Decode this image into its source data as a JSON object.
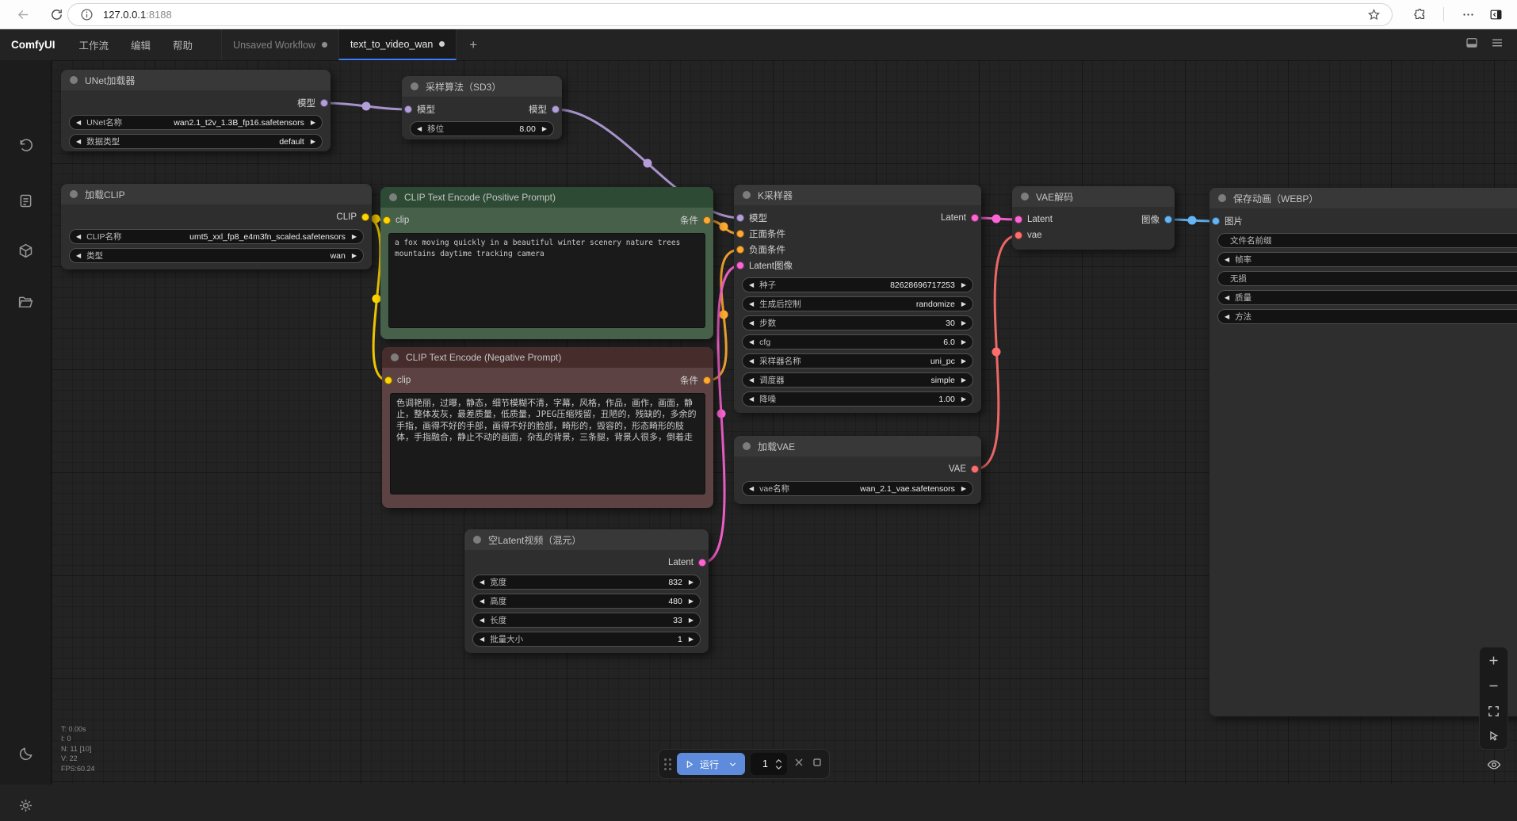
{
  "colors": {
    "model": "#b39ddb",
    "clip": "#ffd500",
    "conditioning": "#ffa931",
    "latent": "#ff64d5",
    "vae": "#ff6e6e",
    "image": "#64b5f6",
    "run_button": "#5f8bdd",
    "active_tab_underline": "#3d7eff"
  },
  "browser": {
    "url_host": "127.0.0.1",
    "url_port": ":8188",
    "icons": [
      "back-icon",
      "refresh-icon",
      "info-icon",
      "star-icon",
      "extensions-puzzle-icon",
      "more-dots-icon",
      "browser-sidebar-icon"
    ]
  },
  "menubar": {
    "logo": "ComfyUI",
    "menu_workflow": "工作流",
    "menu_edit": "编辑",
    "menu_help": "帮助",
    "tab_unsaved": "Unsaved Workflow",
    "tab_active": "text_to_video_wan",
    "icons": [
      "bottom-panel-icon",
      "hamburger-menu-icon"
    ]
  },
  "sidebar_icons": [
    "queue-history-icon",
    "node-library-icon",
    "model-library-icon",
    "workflows-folder-icon",
    "theme-moon-icon",
    "settings-gear-icon"
  ],
  "nodes": {
    "unet_loader": {
      "title": "UNet加载器",
      "outputs": [
        "模型"
      ],
      "widgets": [
        {
          "label": "UNet名称",
          "value": "wan2.1_t2v_1.3B_fp16.safetensors"
        },
        {
          "label": "数据类型",
          "value": "default"
        }
      ]
    },
    "model_sampling": {
      "title": "采样算法（SD3）",
      "inputs": [
        "模型"
      ],
      "outputs": [
        "模型"
      ],
      "widgets": [
        {
          "label": "移位",
          "value": "8.00"
        }
      ]
    },
    "clip_loader": {
      "title": "加载CLIP",
      "outputs": [
        "CLIP"
      ],
      "widgets": [
        {
          "label": "CLIP名称",
          "value": "umt5_xxl_fp8_e4m3fn_scaled.safetensors"
        },
        {
          "label": "类型",
          "value": "wan"
        }
      ]
    },
    "positive": {
      "title": "CLIP Text Encode (Positive Prompt)",
      "inputs": [
        "clip"
      ],
      "outputs": [
        "条件"
      ],
      "text": "a fox moving quickly in a beautiful winter scenery nature trees mountains daytime tracking camera"
    },
    "negative": {
      "title": "CLIP Text Encode (Negative Prompt)",
      "inputs": [
        "clip"
      ],
      "outputs": [
        "条件"
      ],
      "text": "色调艳丽，过曝，静态，细节模糊不清，字幕，风格，作品，画作，画面，静止，整体发灰，最差质量，低质量，JPEG压缩残留，丑陋的，残缺的，多余的手指，画得不好的手部，画得不好的脸部，畸形的，毁容的，形态畸形的肢体，手指融合，静止不动的画面，杂乱的背景，三条腿，背景人很多，倒着走"
    },
    "ksampler": {
      "title": "K采样器",
      "inputs": [
        "模型",
        "正面条件",
        "负面条件",
        "Latent图像"
      ],
      "outputs": [
        "Latent"
      ],
      "widgets": [
        {
          "label": "种子",
          "value": "82628696717253"
        },
        {
          "label": "生成后控制",
          "value": "randomize"
        },
        {
          "label": "步数",
          "value": "30"
        },
        {
          "label": "cfg",
          "value": "6.0"
        },
        {
          "label": "采样器名称",
          "value": "uni_pc"
        },
        {
          "label": "调度器",
          "value": "simple"
        },
        {
          "label": "降噪",
          "value": "1.00"
        }
      ]
    },
    "vae_loader": {
      "title": "加载VAE",
      "outputs": [
        "VAE"
      ],
      "widgets": [
        {
          "label": "vae名称",
          "value": "wan_2.1_vae.safetensors"
        }
      ]
    },
    "vae_decode": {
      "title": "VAE解码",
      "inputs": [
        "Latent",
        "vae"
      ],
      "outputs": [
        "图像"
      ]
    },
    "save_webp": {
      "title": "保存动画（WEBP）",
      "inputs": [
        "图片"
      ],
      "widgets": [
        {
          "label": "文件名前缀"
        },
        {
          "label": "帧率"
        },
        {
          "label": "无损"
        },
        {
          "label": "质量"
        },
        {
          "label": "方法"
        }
      ]
    },
    "empty_latent": {
      "title": "空Latent视频（混元）",
      "outputs": [
        "Latent"
      ],
      "widgets": [
        {
          "label": "宽度",
          "value": "832"
        },
        {
          "label": "高度",
          "value": "480"
        },
        {
          "label": "长度",
          "value": "33"
        },
        {
          "label": "批量大小",
          "value": "1"
        }
      ]
    }
  },
  "stats": {
    "line1": "T: 0.00s",
    "line2": "I: 0",
    "line3": "N: 11 [10]",
    "line4": "V: 22",
    "line5": "FPS:60.24"
  },
  "runbar": {
    "run_label": "运行",
    "batch_count": "1"
  }
}
